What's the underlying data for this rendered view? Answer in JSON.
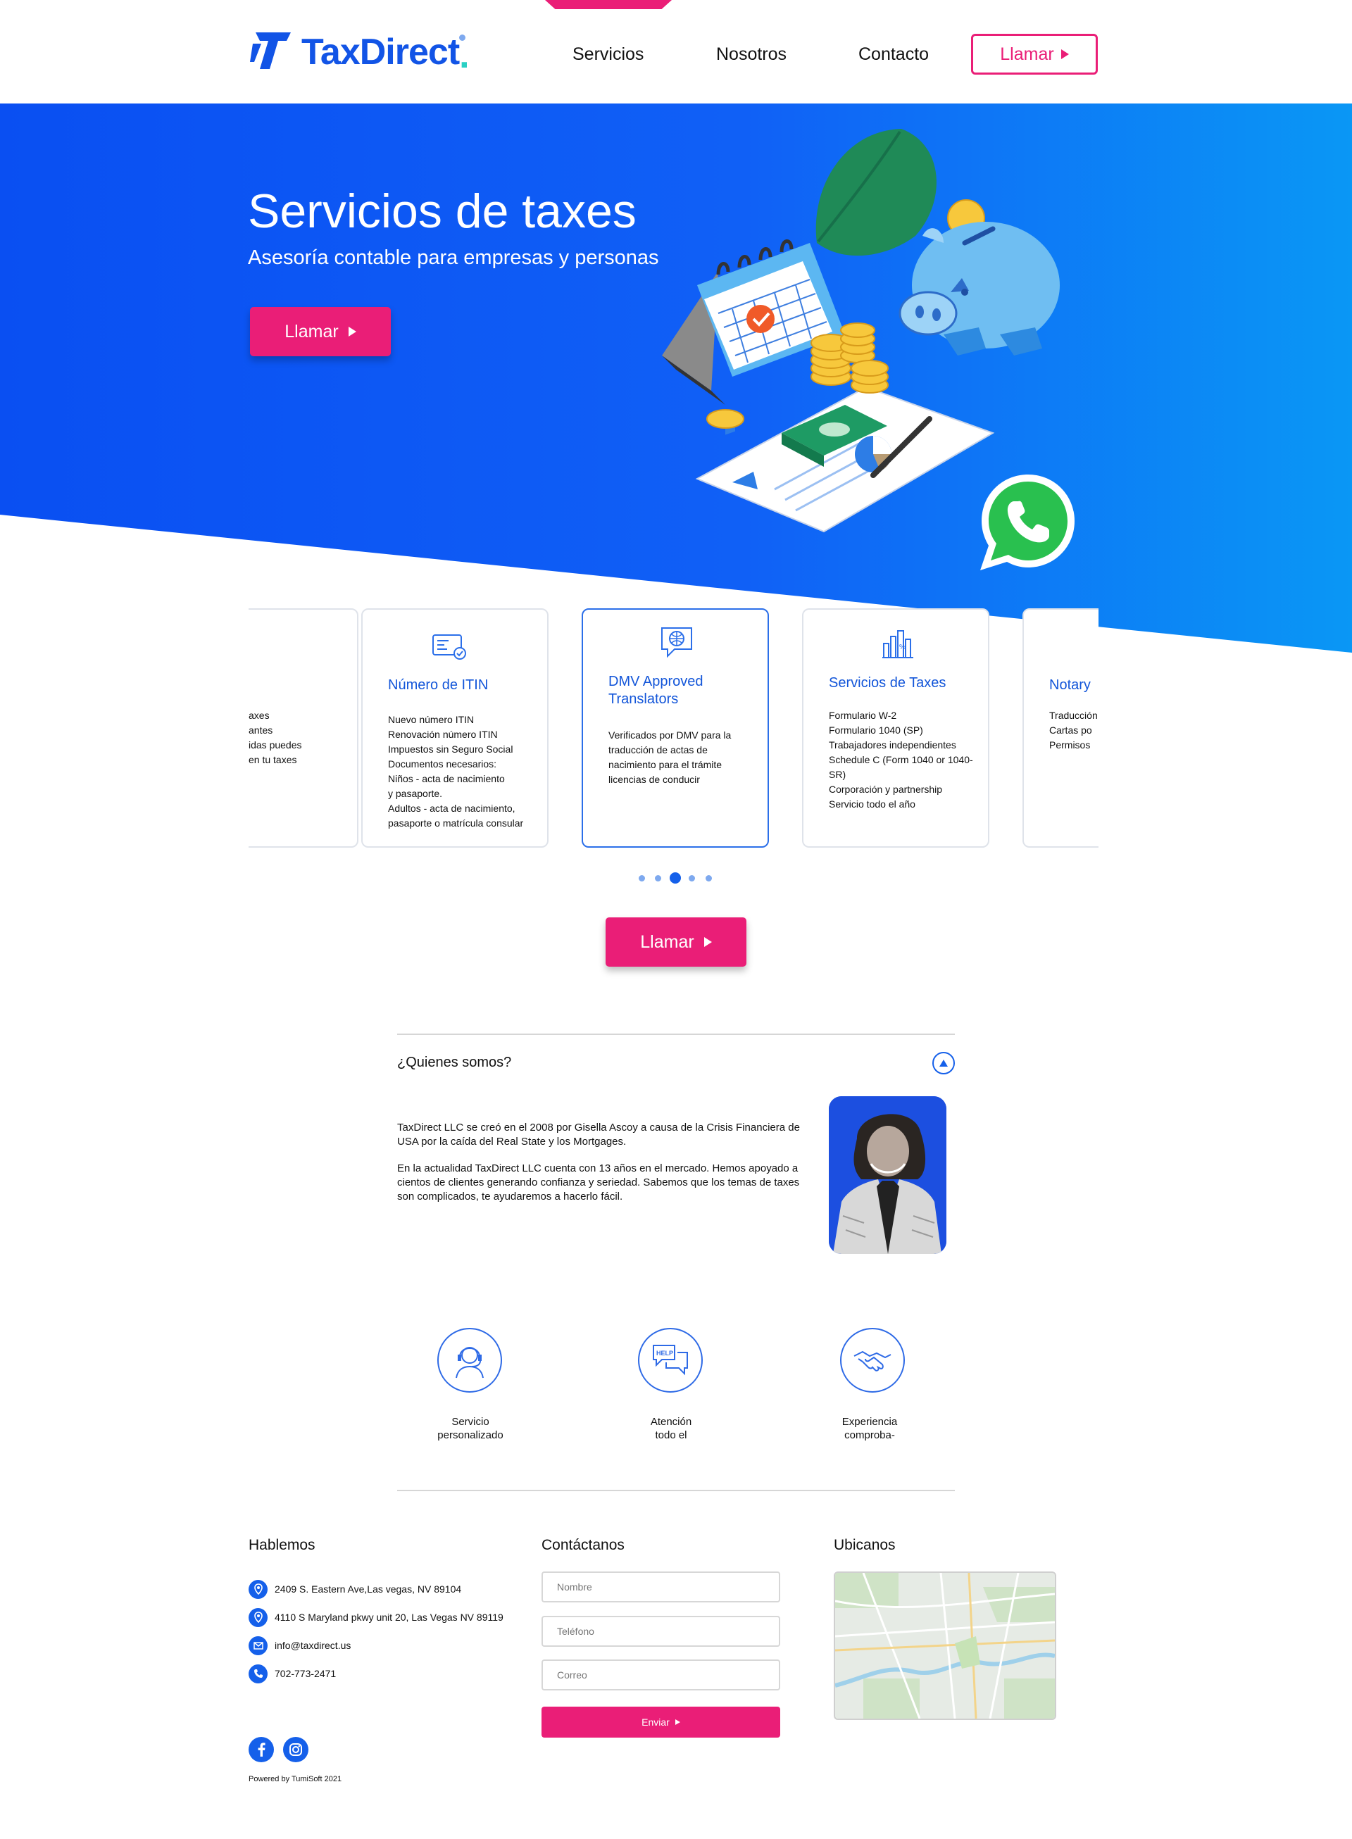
{
  "header": {
    "logo_text_tax": "Tax",
    "logo_text_direct": "Direct",
    "logo_dot": ".",
    "nav": [
      "Servicios",
      "Nosotros",
      "Contacto"
    ],
    "call_button": "Llamar"
  },
  "hero": {
    "title": "Servicios de taxes",
    "subtitle": "Asesoría contable para empresas y personas",
    "call_button": "Llamar"
  },
  "cards": [
    {
      "title": "",
      "body": "axes\nantes\nidas puedes\nen tu taxes",
      "icon": "document-icon"
    },
    {
      "title": "Número de ITIN",
      "body": "Nuevo número ITIN\nRenovación número ITIN\nImpuestos sin Seguro Social\nDocumentos necesarios:\nNiños - acta de nacimiento\ny pasaporte.\nAdultos - acta de nacimiento,\npasaporte o matrícula consular",
      "icon": "id-card-icon"
    },
    {
      "title": "DMV Approved Translators",
      "body": "Verificados por DMV para la\ntraducción de actas de\nnacimiento para el trámite\nlicencias de conducir",
      "icon": "globe-chat-icon"
    },
    {
      "title": "Servicios de Taxes",
      "body": "Formulario W-2\nFormulario 1040 (SP)\nTrabajadores independientes\nSchedule C (Form 1040 or 1040-SR)\nCorporación y partnership\nServicio todo el año",
      "icon": "bar-chart-percent-icon"
    },
    {
      "title": "Notary",
      "body": "Traducción\nCartas po\nPermisos",
      "icon": "stamp-icon"
    }
  ],
  "carousel": {
    "count": 5,
    "active_index": 2
  },
  "mid_call_button": "Llamar",
  "about": {
    "question": "¿Quienes somos?",
    "paragraphs": [
      "TaxDirect LLC se creó en el 2008 por Gisella Ascoy a causa de la Crisis Financiera de USA por la caída del Real State y los Mortgages.",
      "En la actualidad TaxDirect LLC cuenta con 13 años en el mercado. Hemos apoyado a cientos de clientes generando confianza y seriedad. Sabemos que los temas de taxes son complicados, te ayudaremos a hacerlo fácil."
    ]
  },
  "features": [
    {
      "label": "Servicio\npersonalizado",
      "icon": "headset-agent-icon"
    },
    {
      "label": "Atención\ntodo el",
      "icon": "help-chat-icon"
    },
    {
      "label": "Experiencia\ncomproba-",
      "icon": "handshake-icon"
    }
  ],
  "footer": {
    "talk_heading": "Hablemos",
    "contact_heading": "Contáctanos",
    "map_heading": "Ubicanos",
    "address_1": "2409 S. Eastern Ave,Las vegas, NV 89104",
    "address_2": "4110 S Maryland pkwy unit 20, Las Vegas NV 89119",
    "email": "info@taxdirect.us",
    "phone": "702-773-2471",
    "form": {
      "name_placeholder": "Nombre",
      "phone_placeholder": "Teléfono",
      "email_placeholder": "Correo",
      "send_button": "Enviar"
    },
    "powered": "Powered by TumiSoft 2021"
  },
  "colors": {
    "brand_blue": "#1560ea",
    "accent_pink": "#ea1e77",
    "logo_teal": "#2ad0c4"
  }
}
